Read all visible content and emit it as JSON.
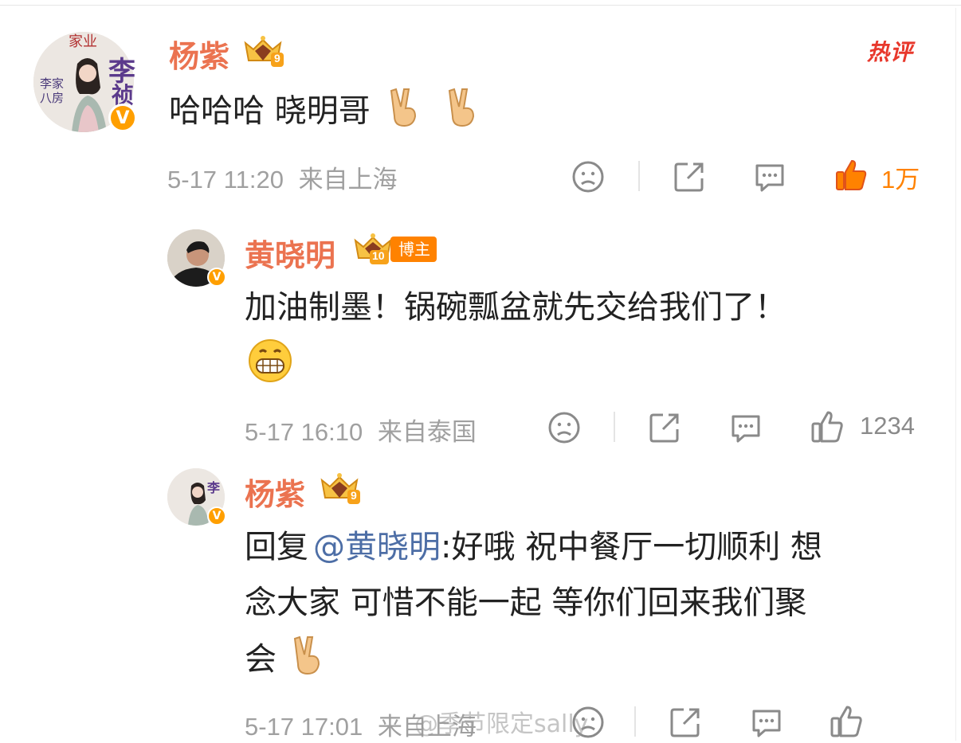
{
  "comment1": {
    "user": "杨紫",
    "level": "9",
    "hot_label": "热评",
    "avatar_text": [
      "家业",
      "李",
      "祯",
      "李家八房"
    ],
    "text": "哈哈哈 晓明哥",
    "time": "5-17 11:20",
    "location": "来自上海",
    "likes": "1万"
  },
  "reply1": {
    "user": "黄晓明",
    "level": "10",
    "tag": "博主",
    "text_line1": "加油制墨！锅碗瓢盆就先交给我们了！",
    "time": "5-17 16:10",
    "location": "来自泰国",
    "likes": "1234"
  },
  "reply2": {
    "user": "杨紫",
    "level": "9",
    "prefix": "回复",
    "mention": "@黄晓明",
    "text_line1": ":好哦 祝中餐厅一切顺利 想",
    "text_line2": "念大家 可惜不能一起 等你们回来我们聚",
    "text_line3": "会",
    "time": "5-17 17:01",
    "location": "来自上海"
  },
  "watermark": "@季节限定sally",
  "colors": {
    "name": "#eb7350",
    "meta": "#a0a0a0",
    "liked": "#ff8200",
    "mention": "#4d6ea6",
    "hot": "#e8382c"
  },
  "icons": [
    "dislike-face-icon",
    "share-icon",
    "comment-icon",
    "like-thumb-icon",
    "victory-hand-emoji",
    "grinning-emoji",
    "verified-v-icon",
    "crown-level-icon"
  ]
}
